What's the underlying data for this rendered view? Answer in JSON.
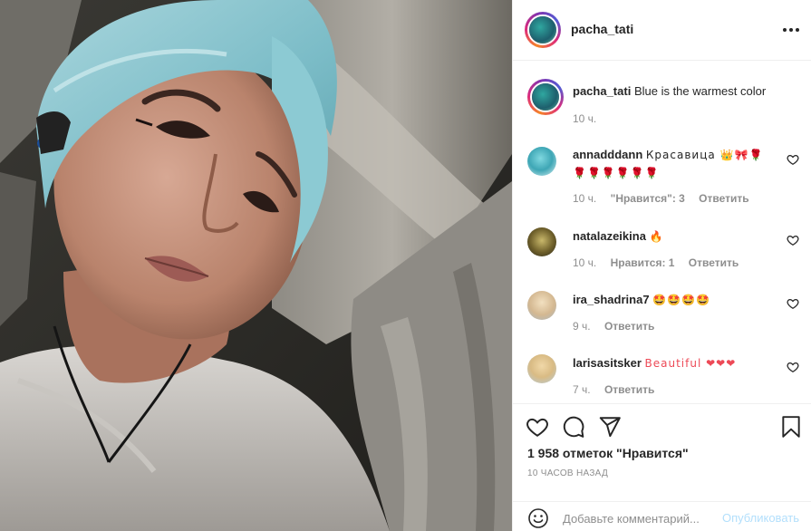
{
  "post": {
    "author": "pacha_tati",
    "more_icon": "more-horizontal-icon"
  },
  "caption": {
    "username": "pacha_tati",
    "text": "Blue is the warmest color",
    "time": "10 ч."
  },
  "comments": [
    {
      "username": "annadddann",
      "text": "Красавица 👑🎀🌹 🌹🌹🌹🌹🌹🌹",
      "time": "10 ч.",
      "likes": "\"Нравится\": 3",
      "reply": "Ответить"
    },
    {
      "username": "natalazeikina",
      "text": "🔥",
      "time": "10 ч.",
      "likes": "Нравится: 1",
      "reply": "Ответить"
    },
    {
      "username": "ira_shadrina7",
      "text": "🤩🤩🤩🤩",
      "time": "9 ч.",
      "reply": "Ответить"
    },
    {
      "username": "larisasitsker",
      "text": "Beautiful ❤❤❤",
      "time": "7 ч.",
      "reply": "Ответить"
    }
  ],
  "actions": {
    "like_icon": "heart-icon",
    "comment_icon": "comment-icon",
    "share_icon": "send-icon",
    "save_icon": "bookmark-icon"
  },
  "likes_text": "1 958 отметок \"Нравится\"",
  "time_ago": "10 часов назад",
  "add_comment": {
    "placeholder": "Добавьте комментарий...",
    "publish_label": "Опубликовать",
    "emoji_icon": "smile-icon"
  },
  "colors": {
    "text": "#262626",
    "muted": "#8e8e8e",
    "border": "#efefef",
    "publish_disabled": "#b2dffc",
    "heart_red": "#ed4956"
  }
}
